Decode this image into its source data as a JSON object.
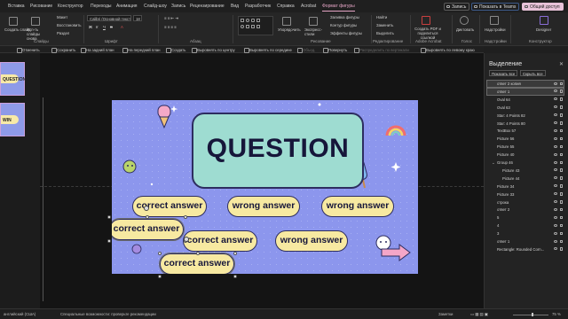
{
  "menu": {
    "tabs": [
      "Вставка",
      "Рисование",
      "Конструктор",
      "Переходы",
      "Анимация",
      "Слайд-шоу",
      "Запись",
      "Рецензирование",
      "Вид",
      "Разработчик",
      "Справка",
      "Acrobat",
      "Формат фигуры"
    ],
    "active_tab": "Формат фигуры",
    "record_label": "Запись",
    "teams_label": "Показать в Teams",
    "share_label": "Общий доступ"
  },
  "ribbon": {
    "create_slide": "Создать слайд",
    "reuse_slides": "Исп-ть слайды снова",
    "layout": "Макет",
    "reset": "Восстановить",
    "section": "Раздел",
    "font_name": "Calibri (Основной текст)",
    "font_size": "18",
    "groups": {
      "slides": "Слайды",
      "font": "Шрифт",
      "paragraph": "Абзац",
      "drawing": "Рисование",
      "editing": "Редактирование",
      "acrobat": "Adobe Acrobat",
      "voice": "Голос",
      "designer": "Конструктор"
    },
    "arrange": "Упорядочить",
    "express_styles": "Экспресс-стили",
    "shape_fill": "Заливка фигуры",
    "shape_outline": "Контур фигуры",
    "shape_effects": "Эффекты фигуры",
    "find": "Найти",
    "replace": "Заменить",
    "select": "Выделить",
    "create_pdf": "Создать PDF и поделиться ссылкой",
    "share_adobe": "Поделиться через Adobe PDF",
    "dictation": "Диктовать",
    "add_ins": "Надстройки",
    "designer": "Designer"
  },
  "quick_toolbar": {
    "items": [
      "Отменить",
      "Сохранить",
      "На задний план",
      "На передний план",
      "Создать",
      "Выровнять по центру",
      "Выровнять по середине",
      "Объед.",
      "Повернуть",
      "Распределить по вертикали",
      "Выровнять по левому краю"
    ]
  },
  "slide": {
    "question": "QUESTION",
    "answers": {
      "a1": "correct answer",
      "a2": "wrong answer",
      "a3": "wrong answer",
      "a4": "correct answer",
      "a5": "correct answer",
      "a6": "wrong answer",
      "a7": "correct answer"
    },
    "thumb_labels": [
      "QUESTION",
      "WIN"
    ],
    "colors": {
      "background": "#8c96ed",
      "question_box": "#9edcd1",
      "answer_pill": "#f7e9a1",
      "outline": "#2d2d60"
    }
  },
  "selection_pane": {
    "title": "Выделение",
    "show_all": "Показать все",
    "hide_all": "Скрыть все",
    "items": [
      {
        "label": "ответ 2 копия",
        "selected": true
      },
      {
        "label": "ответ 1",
        "selected": true
      },
      {
        "label": "Oval 64",
        "selected": false
      },
      {
        "label": "Oval 63",
        "selected": false
      },
      {
        "label": "Star: 4 Points 82",
        "selected": false
      },
      {
        "label": "Star: 4 Points 80",
        "selected": false
      },
      {
        "label": "TextBox 57",
        "selected": false
      },
      {
        "label": "Picture 56",
        "selected": false
      },
      {
        "label": "Picture 55",
        "selected": false
      },
      {
        "label": "Picture 40",
        "selected": false
      },
      {
        "label": "Group 46",
        "selected": false,
        "group": true
      },
      {
        "label": "Picture 43",
        "selected": false,
        "child": true
      },
      {
        "label": "Picture 44",
        "selected": false,
        "child": true
      },
      {
        "label": "Picture 34",
        "selected": false
      },
      {
        "label": "Picture 33",
        "selected": false
      },
      {
        "label": "строка",
        "selected": false
      },
      {
        "label": "ответ 2",
        "selected": false
      },
      {
        "label": "5",
        "selected": false
      },
      {
        "label": "4",
        "selected": false
      },
      {
        "label": "3",
        "selected": false
      },
      {
        "label": "ответ 1",
        "selected": false
      },
      {
        "label": "Rectangle: Rounded Corn...",
        "selected": false
      }
    ]
  },
  "status": {
    "language": "английский (США)",
    "accessibility": "Специальные возможности: проверьте рекомендации",
    "notes": "Заметки",
    "zoom": "75 %",
    "zoom_fraction": 0.55
  }
}
